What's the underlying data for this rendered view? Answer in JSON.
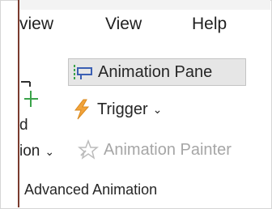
{
  "menubar": {
    "items": [
      "view",
      "View",
      "Help"
    ]
  },
  "ribbon": {
    "add_animation_partial_top": "d",
    "add_animation_partial_bottom": "ion",
    "add_animation_chevron": "⌄",
    "animation_pane_label": "Animation Pane",
    "trigger_label": "Trigger",
    "trigger_chevron": "⌄",
    "animation_painter_label": "Animation Painter",
    "group_label": "Advanced Animation"
  },
  "icons": {
    "add": "plus-icon",
    "animation_pane": "animation-pane-icon",
    "trigger": "lightning-icon",
    "animation_painter": "painter-star-icon"
  },
  "colors": {
    "accent_green": "#3aa34a",
    "trigger_orange": "#f2a33a",
    "selected_bg": "#e6e6e6",
    "frame_accent": "#7a3b2f"
  }
}
